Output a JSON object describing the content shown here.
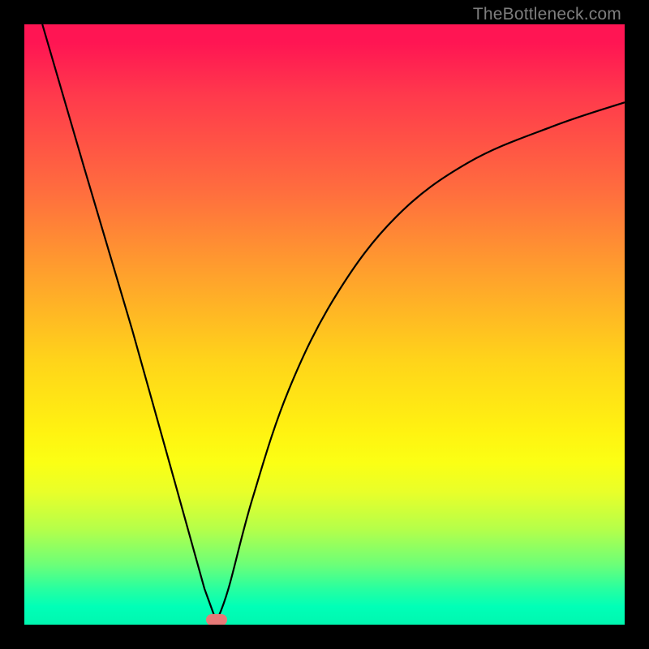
{
  "watermark": "TheBottleneck.com",
  "colors": {
    "background": "#000000",
    "curve": "#000000",
    "marker": "#e77a78"
  },
  "chart_data": {
    "type": "line",
    "title": "",
    "xlabel": "",
    "ylabel": "",
    "xlim": [
      0,
      100
    ],
    "ylim": [
      0,
      100
    ],
    "grid": false,
    "legend": false,
    "notes": "V-shaped bottleneck curve on red-to-green vertical gradient. Left branch roughly linear from top-left toward the minimum; right branch rises with decreasing slope toward the right edge. Minimum touches the bottom (green) band.",
    "minimum": {
      "x": 32,
      "y": 0.5
    },
    "left_branch": [
      {
        "x": 3,
        "y": 100
      },
      {
        "x": 10,
        "y": 76
      },
      {
        "x": 18,
        "y": 49
      },
      {
        "x": 25,
        "y": 24
      },
      {
        "x": 30,
        "y": 6
      },
      {
        "x": 32,
        "y": 0.5
      }
    ],
    "right_branch": [
      {
        "x": 32,
        "y": 0.5
      },
      {
        "x": 34,
        "y": 6
      },
      {
        "x": 38,
        "y": 21
      },
      {
        "x": 44,
        "y": 39
      },
      {
        "x": 52,
        "y": 55
      },
      {
        "x": 62,
        "y": 68
      },
      {
        "x": 74,
        "y": 77
      },
      {
        "x": 88,
        "y": 83
      },
      {
        "x": 100,
        "y": 87
      }
    ],
    "marker": {
      "x": 32,
      "y": 0.8
    }
  }
}
